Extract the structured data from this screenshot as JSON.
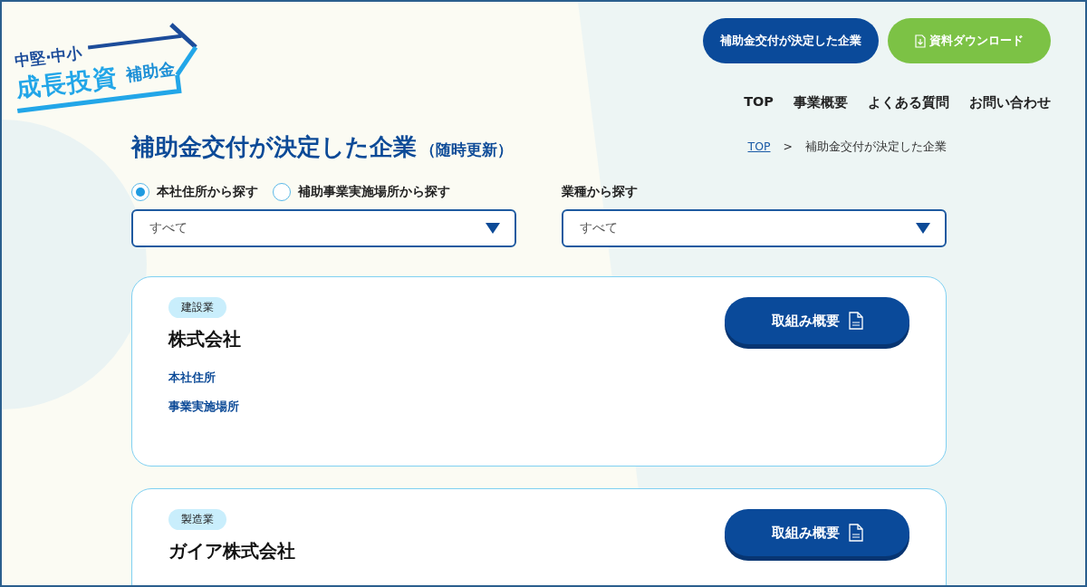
{
  "logo": {
    "line_1": "中堅·中小",
    "line_2": "成長投資",
    "line_3": "補助金"
  },
  "header_buttons": [
    {
      "label": "補助金交付が決定した企業",
      "kind": "primary"
    },
    {
      "label": "資料ダウンロード",
      "kind": "download"
    }
  ],
  "nav": [
    "TOP",
    "事業概要",
    "よくある質問",
    "お問い合わせ"
  ],
  "page_title": {
    "title": "補助金交付が決定した企業",
    "note": "（随時更新）"
  },
  "breadcrumb": {
    "items": [
      {
        "label": "TOP",
        "kind": "link"
      },
      {
        "label": "補助金交付が決定した企業",
        "kind": "current"
      }
    ],
    "separator": ">"
  },
  "filters": {
    "search_modes": [
      {
        "label": "本社住所から探す",
        "selected": true
      },
      {
        "label": "補助事業実施場所から探す",
        "selected": false
      }
    ],
    "area_select": {
      "value": "すべて"
    },
    "industry_select": {
      "label": "業種から探す",
      "value": "すべて"
    }
  },
  "companies": [
    {
      "industry": "建設業",
      "name": "株式会社",
      "details": [
        "本社住所",
        "事業実施場所"
      ],
      "button": "取組み概要"
    },
    {
      "industry": "製造業",
      "name": "ガイア株式会社",
      "button": "取組み概要"
    }
  ]
}
